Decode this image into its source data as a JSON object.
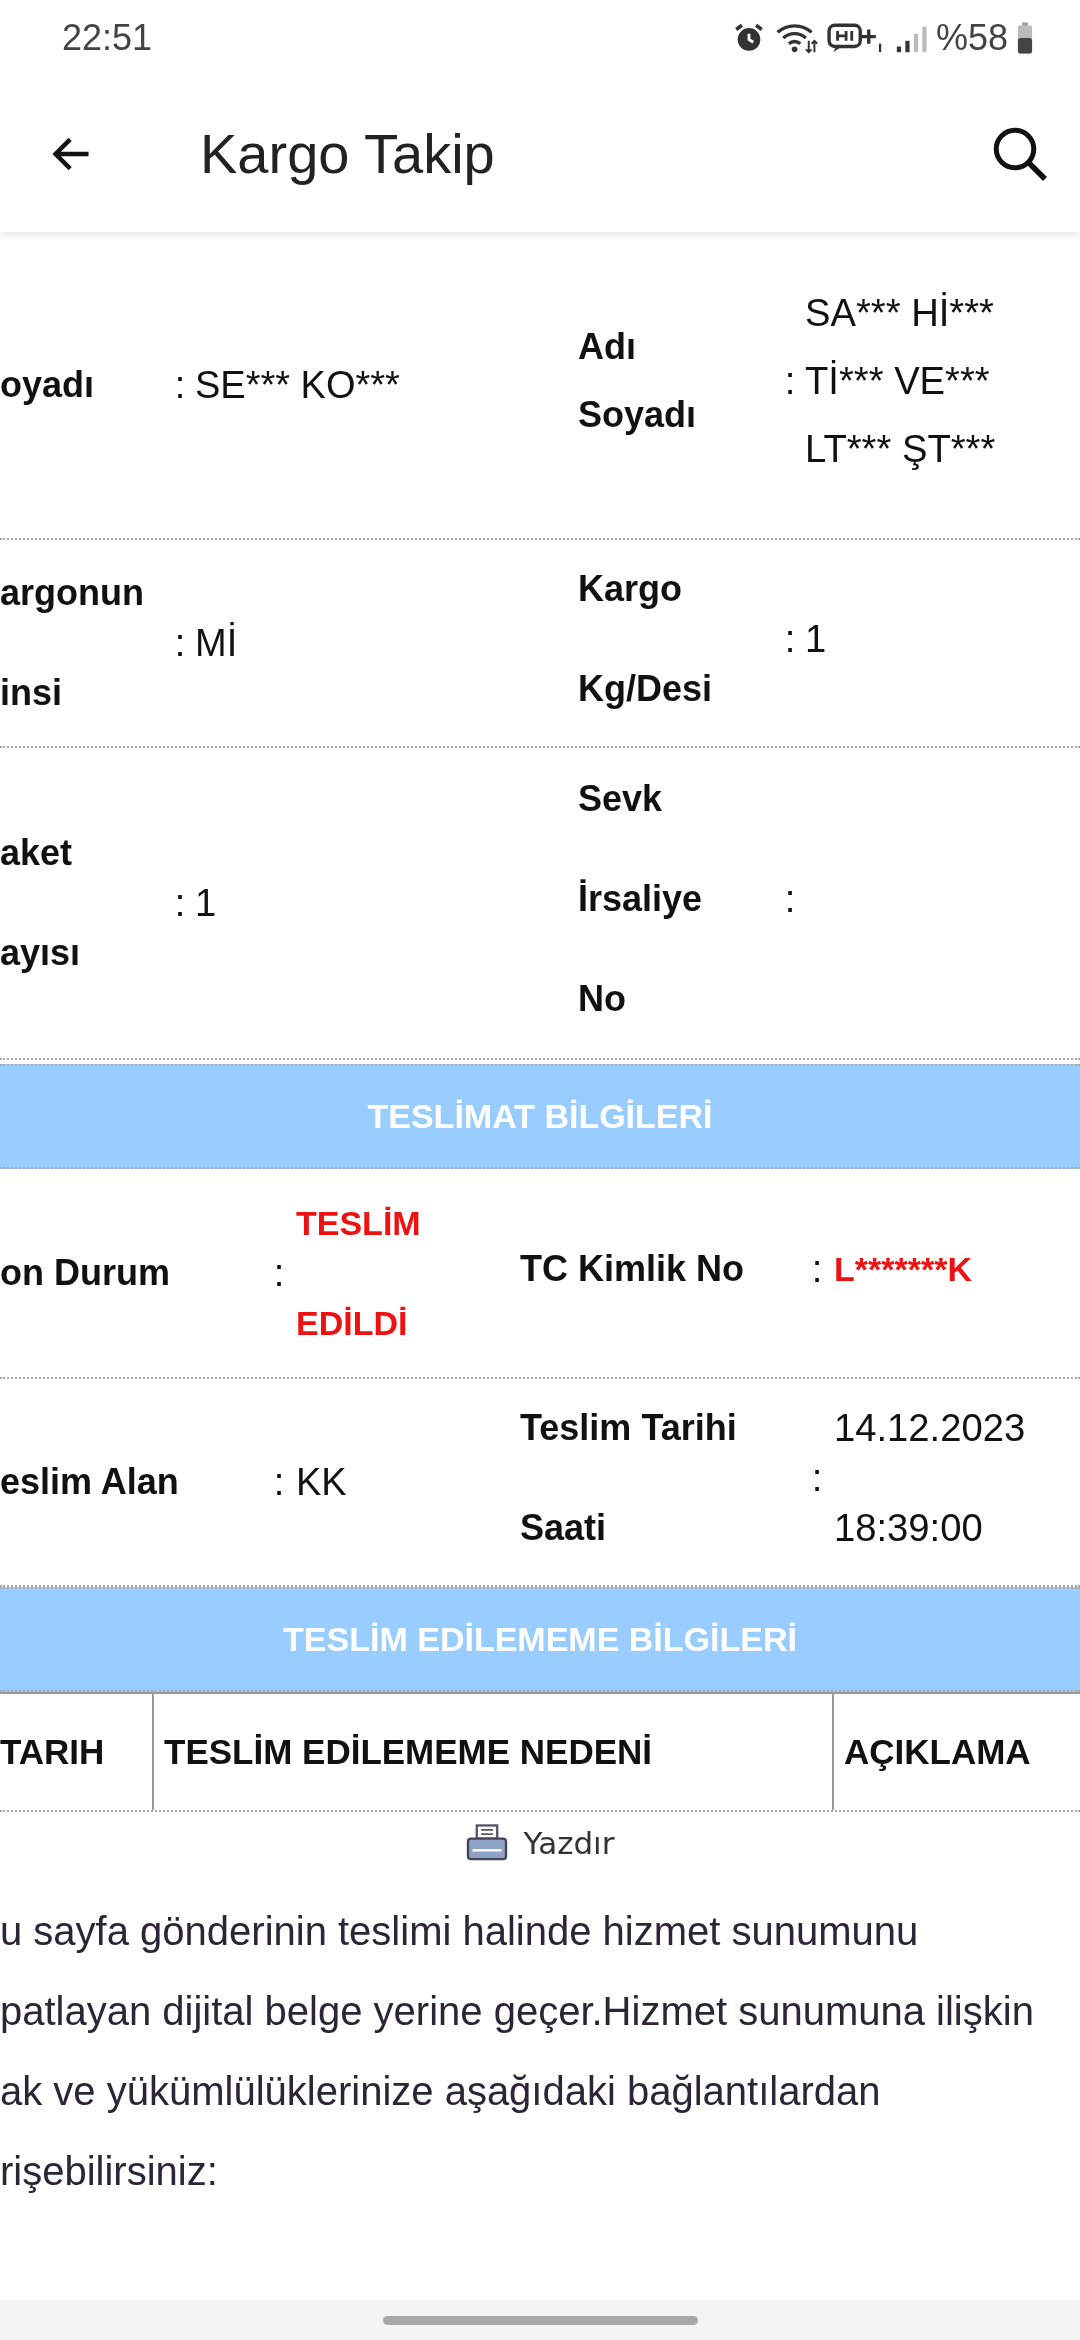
{
  "status_bar": {
    "time": "22:51",
    "battery": "%58"
  },
  "app_bar": {
    "title": "Kargo Takip"
  },
  "detail_rows": [
    {
      "cells": [
        {
          "label": "oyadı",
          "colon": ":",
          "value": "SE*** KO***"
        },
        {
          "label": "Adı\nSoyadı",
          "colon": ":",
          "value": "SA*** Hİ***\nTİ*** VE***\nLT*** ŞT***"
        }
      ]
    },
    {
      "cells": [
        {
          "label": "argonun\ninsi",
          "colon": ":",
          "value": "Mİ"
        },
        {
          "label": "Kargo\nKg/Desi",
          "colon": ":",
          "value": "1"
        }
      ]
    },
    {
      "cells": [
        {
          "label": "aket\nayısı",
          "colon": ":",
          "value": "1"
        },
        {
          "label": "Sevk\nİrsaliye\nNo",
          "colon": ":"
        }
      ]
    }
  ],
  "delivery_section": {
    "title": "TESLİMAT BİLGİLERİ",
    "rows": [
      {
        "cells": [
          {
            "label": "on Durum",
            "colon": ":",
            "value": "TESLİM\nEDİLDİ",
            "emphasis": true
          },
          {
            "label": "TC Kimlik No",
            "colon": ":",
            "value": "L*******K",
            "emphasis": true
          }
        ]
      },
      {
        "cells": [
          {
            "label": "eslim Alan",
            "colon": ":",
            "value": "KK"
          },
          {
            "label": "Teslim Tarihi\nSaati",
            "colon": ":",
            "value": "14.12.2023\n18:39:00"
          }
        ]
      }
    ]
  },
  "failed_section": {
    "title": "TESLİM EDİLEMEME BİLGİLERİ",
    "table": {
      "columns": [
        "TARIH",
        "TESLİM EDİLEMEME NEDENİ",
        "AÇIKLAMA"
      ]
    }
  },
  "print_link": "Yazdır",
  "notice_lines": [
    "u sayfa gönderinin teslimi halinde hizmet sunumunu",
    "patlayan dijital belge yerine geçer.Hizmet sunumuna ilişkin",
    "ak ve yükümlülüklerinize aşağıdaki bağlantılardan",
    "rişebilirsiniz:"
  ]
}
